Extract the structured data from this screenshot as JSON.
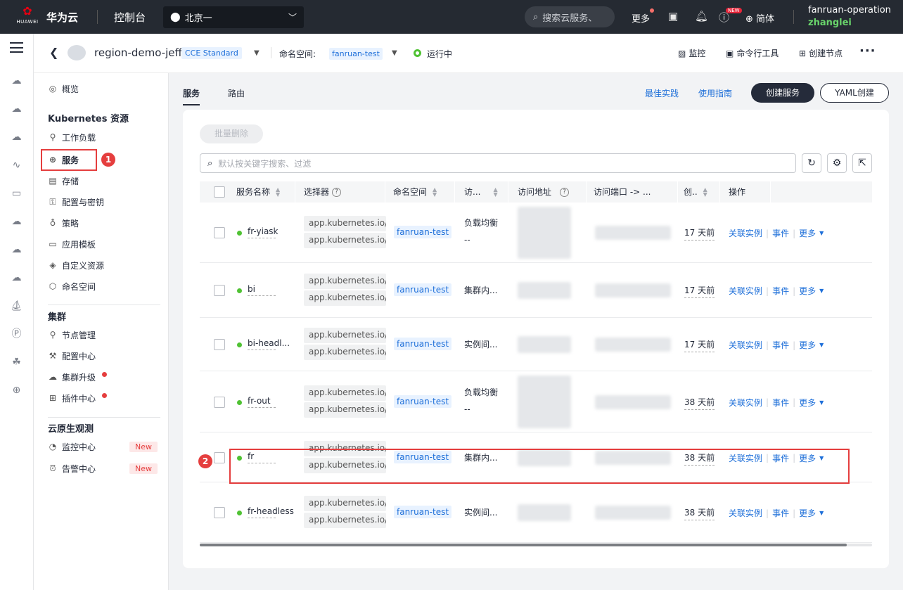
{
  "topbar": {
    "logo_text": "HUAWEI",
    "brand": "华为云",
    "console": "控制台",
    "region": "北京一",
    "search_placeholder": "搜索云服务、",
    "more": "更多",
    "new_badge": "NEW",
    "lang": "简体",
    "user_account": "fanruan-operation",
    "user_name": "zhanglei"
  },
  "cluster_bar": {
    "cluster_name": "region-demo-jeff",
    "cluster_type": "CCE Standard",
    "namespace_label": "命名空间:",
    "namespace": "fanruan-test",
    "status": "运行中",
    "actions": {
      "monitor": "监控",
      "cli": "命令行工具",
      "create_node": "创建节点"
    }
  },
  "sidenav": {
    "overview": "概览",
    "k8s_section": "Kubernetes 资源",
    "workload": "工作负载",
    "service": "服务",
    "storage": "存储",
    "config_secret": "配置与密钥",
    "policy": "策略",
    "app_template": "应用模板",
    "custom_resource": "自定义资源",
    "namespace": "命名空间",
    "cluster_section": "集群",
    "node_mgmt": "节点管理",
    "config_center": "配置中心",
    "cluster_upgrade": "集群升级",
    "addon_center": "插件中心",
    "observe_section": "云原生观测",
    "monitor_center": "监控中心",
    "alarm_center": "告警中心",
    "new_label": "New",
    "step1": "1",
    "step2": "2"
  },
  "main": {
    "tab_service": "服务",
    "tab_route": "路由",
    "best_practice": "最佳实践",
    "user_guide": "使用指南",
    "create_service": "创建服务",
    "yaml_create": "YAML创建",
    "batch_delete": "批量删除",
    "search_placeholder": "默认按关键字搜索、过滤"
  },
  "table": {
    "headers": {
      "name": "服务名称",
      "selector": "选择器",
      "namespace": "命名空间",
      "access_type": "访...",
      "access_addr": "访问地址",
      "access_port": "访问端口 -> ...",
      "created": "创..",
      "ops": "操作"
    },
    "ops": {
      "related": "关联实例",
      "events": "事件",
      "more": "更多"
    },
    "rows": [
      {
        "name": "fr-yiask",
        "sel1": "app.kubernetes.io/instance",
        "sel2": "app.kubernetes.io/name",
        "ns": "fanruan-test",
        "type1": "负载均衡",
        "type2": "--",
        "created": "17 天前"
      },
      {
        "name": "bi",
        "sel1": "app.kubernetes.io/instance",
        "sel2": "app.kubernetes.io/name",
        "ns": "fanruan-test",
        "type1": "集群内...",
        "type2": "",
        "created": "17 天前"
      },
      {
        "name": "bi-headl...",
        "sel1": "app.kubernetes.io/instance",
        "sel2": "app.kubernetes.io/name",
        "ns": "fanruan-test",
        "type1": "实例间...",
        "type2": "",
        "created": "17 天前"
      },
      {
        "name": "fr-out",
        "sel1": "app.kubernetes.io/instance",
        "sel2": "app.kubernetes.io/name",
        "ns": "fanruan-test",
        "type1": "负载均衡",
        "type2": "--",
        "created": "38 天前"
      },
      {
        "name": "fr",
        "sel1": "app.kubernetes.io/instance",
        "sel2": "app.kubernetes.io/name",
        "ns": "fanruan-test",
        "type1": "集群内...",
        "type2": "",
        "created": "38 天前"
      },
      {
        "name": "fr-headless",
        "sel1": "app.kubernetes.io/instance",
        "sel2": "app.kubernetes.io/name",
        "ns": "fanruan-test",
        "type1": "实例间...",
        "type2": "",
        "created": "38 天前"
      }
    ]
  },
  "colors": {
    "topbar": "#252a32",
    "accent": "#1e6fd9",
    "highlight": "#e53e3e",
    "status_green": "#50c234"
  }
}
